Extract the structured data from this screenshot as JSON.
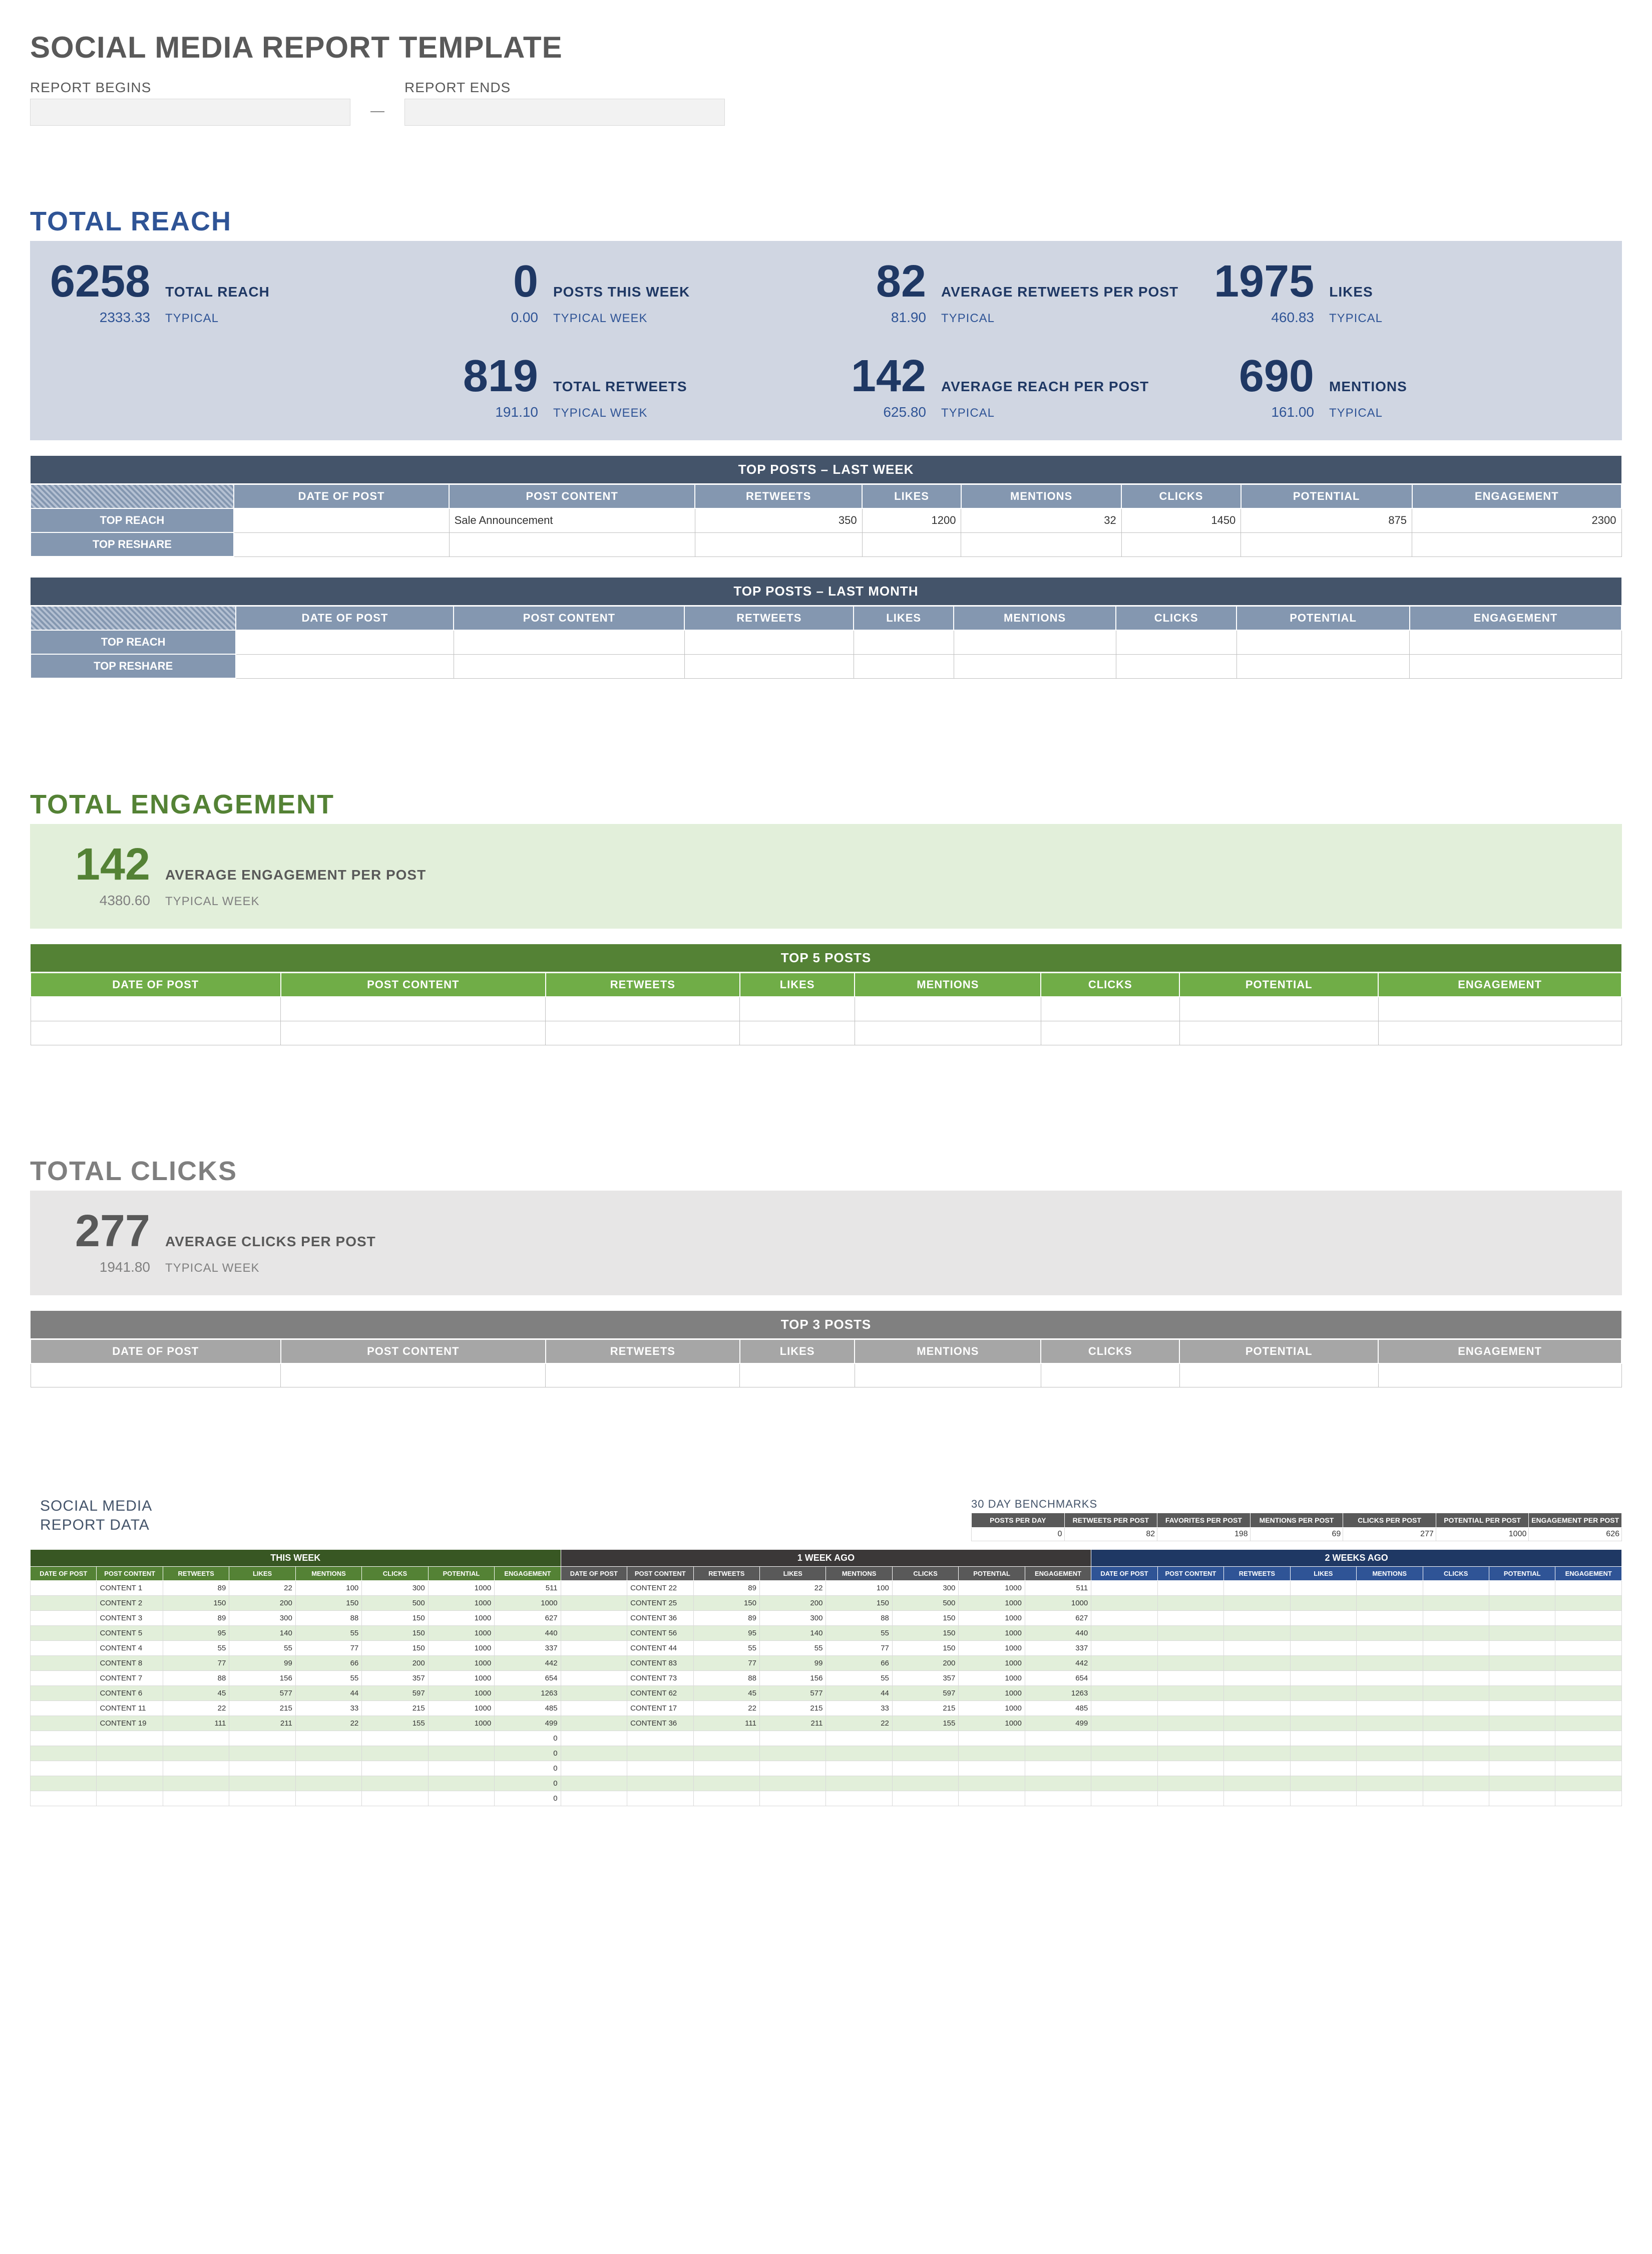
{
  "page": {
    "title": "SOCIAL MEDIA REPORT TEMPLATE",
    "report_begins_label": "REPORT BEGINS",
    "report_ends_label": "REPORT ENDS",
    "dash": "—"
  },
  "reach": {
    "section_title": "TOTAL REACH",
    "typical_label": "TYPICAL",
    "typical_week_label": "TYPICAL WEEK",
    "metrics": [
      {
        "value": "6258",
        "label": "TOTAL REACH",
        "sub": "2333.33",
        "sublabel": "TYPICAL"
      },
      {
        "value": "0",
        "label": "POSTS THIS WEEK",
        "sub": "0.00",
        "sublabel": "TYPICAL WEEK"
      },
      {
        "value": "82",
        "label": "AVERAGE RETWEETS PER POST",
        "sub": "81.90",
        "sublabel": "TYPICAL"
      },
      {
        "value": "1975",
        "label": "LIKES",
        "sub": "460.83",
        "sublabel": "TYPICAL"
      },
      {
        "value": "819",
        "label": "TOTAL RETWEETS",
        "sub": "191.10",
        "sublabel": "TYPICAL WEEK"
      },
      {
        "value": "142",
        "label": "AVERAGE REACH PER POST",
        "sub": "625.80",
        "sublabel": "TYPICAL"
      },
      {
        "value": "690",
        "label": "MENTIONS",
        "sub": "161.00",
        "sublabel": "TYPICAL"
      }
    ],
    "top_last_week": {
      "caption": "TOP POSTS – LAST WEEK",
      "columns": [
        "DATE OF POST",
        "POST CONTENT",
        "RETWEETS",
        "LIKES",
        "MENTIONS",
        "CLICKS",
        "POTENTIAL",
        "ENGAGEMENT"
      ],
      "row_labels": [
        "TOP REACH",
        "TOP RESHARE"
      ],
      "rows": [
        {
          "date": "",
          "content": "Sale Announcement",
          "retweets": "350",
          "likes": "1200",
          "mentions": "32",
          "clicks": "1450",
          "potential": "875",
          "engagement": "2300"
        },
        {
          "date": "",
          "content": "",
          "retweets": "",
          "likes": "",
          "mentions": "",
          "clicks": "",
          "potential": "",
          "engagement": ""
        }
      ]
    },
    "top_last_month": {
      "caption": "TOP POSTS – LAST MONTH",
      "columns": [
        "DATE OF POST",
        "POST CONTENT",
        "RETWEETS",
        "LIKES",
        "MENTIONS",
        "CLICKS",
        "POTENTIAL",
        "ENGAGEMENT"
      ],
      "row_labels": [
        "TOP REACH",
        "TOP RESHARE"
      ]
    }
  },
  "engagement": {
    "section_title": "TOTAL ENGAGEMENT",
    "metric": {
      "value": "142",
      "label": "AVERAGE ENGAGEMENT PER POST",
      "sub": "4380.60",
      "sublabel": "TYPICAL WEEK"
    },
    "top5": {
      "caption": "TOP 5 POSTS",
      "columns": [
        "DATE OF POST",
        "POST CONTENT",
        "RETWEETS",
        "LIKES",
        "MENTIONS",
        "CLICKS",
        "POTENTIAL",
        "ENGAGEMENT"
      ]
    }
  },
  "clicks": {
    "section_title": "TOTAL CLICKS",
    "metric": {
      "value": "277",
      "label": "AVERAGE CLICKS PER POST",
      "sub": "1941.80",
      "sublabel": "TYPICAL WEEK"
    },
    "top3": {
      "caption": "TOP 3 POSTS",
      "columns": [
        "DATE OF POST",
        "POST CONTENT",
        "RETWEETS",
        "LIKES",
        "MENTIONS",
        "CLICKS",
        "POTENTIAL",
        "ENGAGEMENT"
      ]
    }
  },
  "data_section": {
    "title1": "SOCIAL MEDIA",
    "title2": "REPORT DATA",
    "benchmarks_title": "30 DAY BENCHMARKS",
    "bench_cols": [
      "POSTS PER DAY",
      "RETWEETS PER POST",
      "FAVORITES PER POST",
      "MENTIONS PER POST",
      "CLICKS PER POST",
      "POTENTIAL PER POST",
      "ENGAGEMENT PER POST"
    ],
    "bench_vals": [
      "0",
      "82",
      "198",
      "69",
      "277",
      "1000",
      "626"
    ],
    "periods": [
      "THIS WEEK",
      "1 WEEK AGO",
      "2 WEEKS AGO"
    ],
    "data_cols": [
      "DATE OF POST",
      "POST CONTENT",
      "RETWEETS",
      "LIKES",
      "MENTIONS",
      "CLICKS",
      "POTENTIAL",
      "ENGAGEMENT"
    ],
    "this_week": [
      [
        "",
        "CONTENT 1",
        "89",
        "22",
        "100",
        "300",
        "1000",
        "511"
      ],
      [
        "",
        "CONTENT 2",
        "150",
        "200",
        "150",
        "500",
        "1000",
        "1000"
      ],
      [
        "",
        "CONTENT 3",
        "89",
        "300",
        "88",
        "150",
        "1000",
        "627"
      ],
      [
        "",
        "CONTENT 5",
        "95",
        "140",
        "55",
        "150",
        "1000",
        "440"
      ],
      [
        "",
        "CONTENT 4",
        "55",
        "55",
        "77",
        "150",
        "1000",
        "337"
      ],
      [
        "",
        "CONTENT 8",
        "77",
        "99",
        "66",
        "200",
        "1000",
        "442"
      ],
      [
        "",
        "CONTENT 7",
        "88",
        "156",
        "55",
        "357",
        "1000",
        "654"
      ],
      [
        "",
        "CONTENT 6",
        "45",
        "577",
        "44",
        "597",
        "1000",
        "1263"
      ],
      [
        "",
        "CONTENT 11",
        "22",
        "215",
        "33",
        "215",
        "1000",
        "485"
      ],
      [
        "",
        "CONTENT 19",
        "111",
        "211",
        "22",
        "155",
        "1000",
        "499"
      ],
      [
        "",
        "",
        "",
        "",
        "",
        "",
        "",
        "0"
      ],
      [
        "",
        "",
        "",
        "",
        "",
        "",
        "",
        "0"
      ],
      [
        "",
        "",
        "",
        "",
        "",
        "",
        "",
        "0"
      ],
      [
        "",
        "",
        "",
        "",
        "",
        "",
        "",
        "0"
      ],
      [
        "",
        "",
        "",
        "",
        "",
        "",
        "",
        "0"
      ]
    ],
    "one_week": [
      [
        "",
        "CONTENT 22",
        "89",
        "22",
        "100",
        "300",
        "1000",
        "511"
      ],
      [
        "",
        "CONTENT 25",
        "150",
        "200",
        "150",
        "500",
        "1000",
        "1000"
      ],
      [
        "",
        "CONTENT 36",
        "89",
        "300",
        "88",
        "150",
        "1000",
        "627"
      ],
      [
        "",
        "CONTENT 56",
        "95",
        "140",
        "55",
        "150",
        "1000",
        "440"
      ],
      [
        "",
        "CONTENT 44",
        "55",
        "55",
        "77",
        "150",
        "1000",
        "337"
      ],
      [
        "",
        "CONTENT 83",
        "77",
        "99",
        "66",
        "200",
        "1000",
        "442"
      ],
      [
        "",
        "CONTENT 73",
        "88",
        "156",
        "55",
        "357",
        "1000",
        "654"
      ],
      [
        "",
        "CONTENT 62",
        "45",
        "577",
        "44",
        "597",
        "1000",
        "1263"
      ],
      [
        "",
        "CONTENT 17",
        "22",
        "215",
        "33",
        "215",
        "1000",
        "485"
      ],
      [
        "",
        "CONTENT 36",
        "111",
        "211",
        "22",
        "155",
        "1000",
        "499"
      ],
      [
        "",
        "",
        "",
        "",
        "",
        "",
        "",
        ""
      ],
      [
        "",
        "",
        "",
        "",
        "",
        "",
        "",
        ""
      ],
      [
        "",
        "",
        "",
        "",
        "",
        "",
        "",
        ""
      ],
      [
        "",
        "",
        "",
        "",
        "",
        "",
        "",
        ""
      ],
      [
        "",
        "",
        "",
        "",
        "",
        "",
        "",
        ""
      ]
    ],
    "two_week": [
      [
        "",
        "",
        "",
        "",
        "",
        "",
        "",
        ""
      ],
      [
        "",
        "",
        "",
        "",
        "",
        "",
        "",
        ""
      ],
      [
        "",
        "",
        "",
        "",
        "",
        "",
        "",
        ""
      ],
      [
        "",
        "",
        "",
        "",
        "",
        "",
        "",
        ""
      ],
      [
        "",
        "",
        "",
        "",
        "",
        "",
        "",
        ""
      ],
      [
        "",
        "",
        "",
        "",
        "",
        "",
        "",
        ""
      ],
      [
        "",
        "",
        "",
        "",
        "",
        "",
        "",
        ""
      ],
      [
        "",
        "",
        "",
        "",
        "",
        "",
        "",
        ""
      ],
      [
        "",
        "",
        "",
        "",
        "",
        "",
        "",
        ""
      ],
      [
        "",
        "",
        "",
        "",
        "",
        "",
        "",
        ""
      ],
      [
        "",
        "",
        "",
        "",
        "",
        "",
        "",
        ""
      ],
      [
        "",
        "",
        "",
        "",
        "",
        "",
        "",
        ""
      ],
      [
        "",
        "",
        "",
        "",
        "",
        "",
        "",
        ""
      ],
      [
        "",
        "",
        "",
        "",
        "",
        "",
        "",
        ""
      ],
      [
        "",
        "",
        "",
        "",
        "",
        "",
        "",
        ""
      ]
    ]
  },
  "chart_data": [
    {
      "type": "table",
      "title": "TOTAL REACH summary metrics",
      "rows": [
        {
          "metric": "Total Reach",
          "value": 6258,
          "typical": 2333.33
        },
        {
          "metric": "Posts This Week",
          "value": 0,
          "typical_week": 0.0
        },
        {
          "metric": "Average Retweets Per Post",
          "value": 82,
          "typical": 81.9
        },
        {
          "metric": "Likes",
          "value": 1975,
          "typical": 460.83
        },
        {
          "metric": "Total Retweets",
          "value": 819,
          "typical_week": 191.1
        },
        {
          "metric": "Average Reach Per Post",
          "value": 142,
          "typical": 625.8
        },
        {
          "metric": "Mentions",
          "value": 690,
          "typical": 161.0
        }
      ]
    },
    {
      "type": "table",
      "title": "30 DAY BENCHMARKS",
      "columns": [
        "POSTS PER DAY",
        "RETWEETS PER POST",
        "FAVORITES PER POST",
        "MENTIONS PER POST",
        "CLICKS PER POST",
        "POTENTIAL PER POST",
        "ENGAGEMENT PER POST"
      ],
      "values": [
        0,
        82,
        198,
        69,
        277,
        1000,
        626
      ]
    }
  ]
}
